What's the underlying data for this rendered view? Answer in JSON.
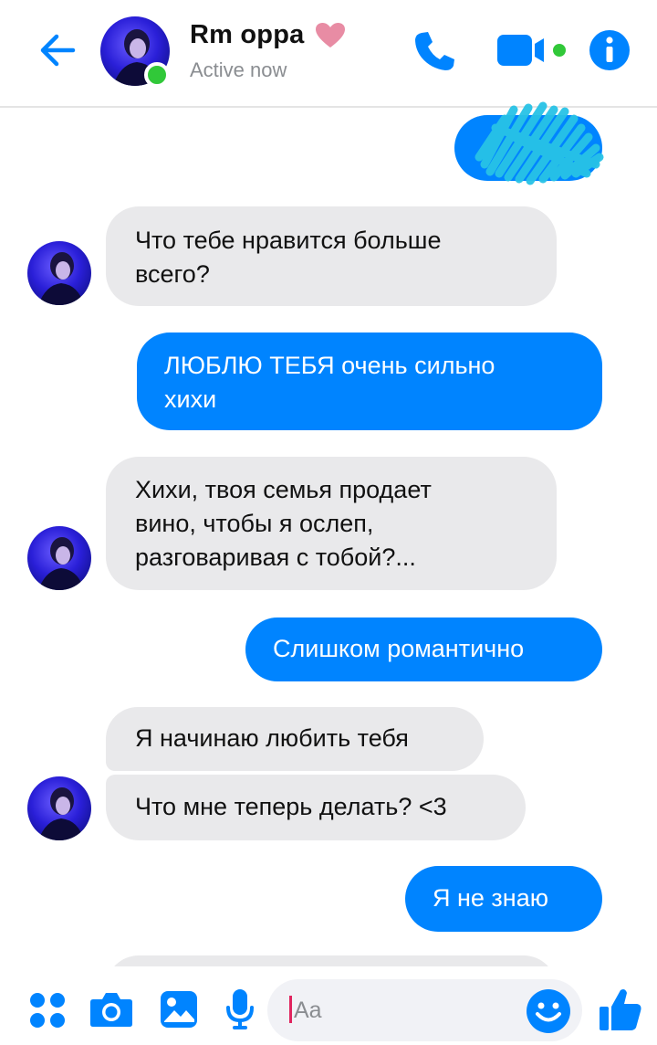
{
  "header": {
    "contact_name": "Rm oppa",
    "status": "Active now",
    "icons": [
      "back-arrow-icon",
      "heart-icon",
      "phone-icon",
      "video-camera-icon",
      "info-icon"
    ]
  },
  "colors": {
    "accent": "#0084ff",
    "incoming_bubble": "#e9e9eb",
    "online": "#31c839",
    "heart": "#e88ca4"
  },
  "messages": [
    {
      "from": "me",
      "text": ""
    },
    {
      "from": "contact",
      "line1": "Что тебе нравится больше",
      "line2": "всего?"
    },
    {
      "from": "me",
      "line1": "ЛЮБЛЮ ТЕБЯ очень сильно",
      "line2": "хихи"
    },
    {
      "from": "contact",
      "line1": "Хихи, твоя семья продает",
      "line2": "вино, чтобы я ослеп,",
      "line3": "разговаривая с тобой?..."
    },
    {
      "from": "me",
      "text": "Слишком романтично"
    },
    {
      "from": "contact",
      "text": "Я начинаю любить тебя"
    },
    {
      "from": "contact",
      "text": "Что мне теперь делать? <3"
    },
    {
      "from": "me",
      "text": "Я не знаю"
    }
  ],
  "composer": {
    "placeholder": "Aa",
    "icons": [
      "apps-icon",
      "camera-icon",
      "gallery-icon",
      "microphone-icon",
      "emoji-icon",
      "like-icon"
    ]
  }
}
